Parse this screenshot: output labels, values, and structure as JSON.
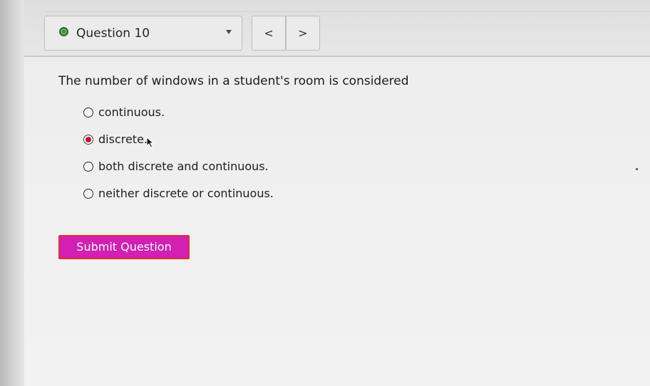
{
  "header": {
    "question_selector": {
      "label": "Question 10",
      "status": "answered",
      "status_icon": "status-dot-icon",
      "status_color": "#3f8f3c",
      "dropdown_icon": "caret-down-icon"
    },
    "pager": {
      "prev_label": "<",
      "next_label": ">"
    }
  },
  "question": {
    "prompt": "The number of windows in a student's room is considered",
    "options": [
      {
        "label": "continuous.",
        "selected": false
      },
      {
        "label": "discrete.",
        "selected": true
      },
      {
        "label": "both discrete and continuous.",
        "selected": false
      },
      {
        "label": "neither discrete or continuous.",
        "selected": false
      }
    ],
    "selected_radio_color": "#c8102e"
  },
  "actions": {
    "submit_label": "Submit Question",
    "submit_color": "#d31fb3",
    "submit_border_color": "#e0312d"
  }
}
